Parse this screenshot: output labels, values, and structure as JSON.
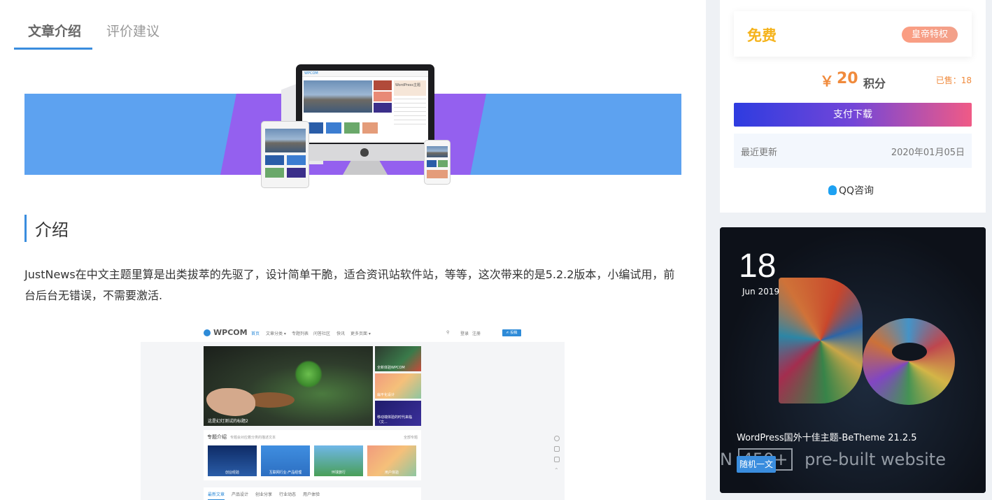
{
  "tabs": [
    {
      "label": "文章介绍",
      "active": true
    },
    {
      "label": "评价建议",
      "active": false
    }
  ],
  "section": {
    "title": "介绍",
    "text": "JustNews在中文主题里算是出类拔萃的先驱了，设计简单干脆，适合资讯站软件站，等等，这次带来的是5.2.2版本，小编试用，前台后台无错误，不需要激活."
  },
  "hero": {
    "screen_logo": "WPCOM",
    "screen_badge": "WordPress主题"
  },
  "preview": {
    "logo": "WPCOM",
    "nav": [
      "首页",
      "文章分类 ▾",
      "专题列表",
      "问答社区",
      "快讯",
      "更多页面 ▾"
    ],
    "login": "登录",
    "register": "注册",
    "post_button": "✍ 投稿",
    "main_caption": "这是幻灯测试的标题2",
    "side_items": [
      {
        "caption": "全新体验WPCOM"
      },
      {
        "caption": "扁平化设计"
      },
      {
        "caption": "移动端体验的时代来临（文..."
      }
    ],
    "card_title": "专题介绍",
    "card_sub": "专题会对应着分类的描述文本",
    "card_more": "全部专题",
    "thumbs": [
      "创业经验",
      "互联网行业·产品经理",
      "环球旅行",
      "用户体验"
    ],
    "tabs": [
      "最新文章",
      "产品设计",
      "创业分享",
      "行业动态",
      "用户体验"
    ],
    "colors": {
      "accent": "#2e8bd8"
    }
  },
  "sidebar": {
    "free_label": "免费",
    "vip_badge": "皇帝特权",
    "price_symbol": "￥",
    "price_value": "20",
    "price_unit": "积分",
    "sold": "已售：18",
    "pay_button": "支付下载",
    "update_label": "最近更新",
    "update_date": "2020年01月05日",
    "qq_label": "QQ咨询",
    "qq_icon": "qq-icon"
  },
  "post": {
    "day": "18",
    "month": "Jun 2019",
    "title": "WordPress国外十佳主题-BeTheme 21.2.5",
    "tag": "随机一文",
    "ghost_prefix": "N",
    "ghost_number": "450+",
    "ghost_suffix": "pre-built website"
  },
  "colors": {
    "accent": "#3a8dde",
    "price": "#f08a3c",
    "free": "#f5b31b"
  }
}
